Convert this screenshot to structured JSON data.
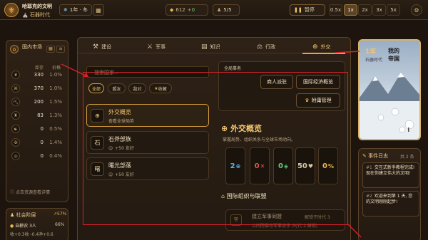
{
  "header": {
    "civ_name": "哈耶克的文明",
    "era": "石器时代",
    "year": "1年 · 冬",
    "gold": "612",
    "gold_delta": "+0",
    "population": "5/5",
    "pause_label": "暂停",
    "speeds": [
      "0.5x",
      "1x",
      "2x",
      "3x",
      "5x"
    ],
    "active_speed": "1x"
  },
  "left_panel": {
    "market_title": "国内市场",
    "col_stock": "库存",
    "col_price": "价格",
    "resources": [
      {
        "icon": "grain-icon",
        "glyph": "❦",
        "stock": "330",
        "price": "1.0%"
      },
      {
        "icon": "wood-icon",
        "glyph": "⌘",
        "stock": "370",
        "price": "1.0%"
      },
      {
        "icon": "stone-icon",
        "glyph": "⛏",
        "stock": "200",
        "price": "1.5%"
      },
      {
        "icon": "tool-icon",
        "glyph": "♜",
        "stock": "83",
        "price": "1.3%"
      },
      {
        "icon": "cloth-icon",
        "glyph": "☯",
        "stock": "0",
        "price": "0.5%"
      },
      {
        "icon": "craft-icon",
        "glyph": "✠",
        "stock": "0",
        "price": "1.4%"
      },
      {
        "icon": "gem-icon",
        "glyph": "◎",
        "stock": "0",
        "price": "0.4%"
      }
    ],
    "hint": "点击资源查看详情",
    "social_title": "社会阶层",
    "social_pct": "57%",
    "class_name": "自耕农 3人",
    "class_pct": "66%",
    "class_stats": "收+0.3收 -0.4净+0.6"
  },
  "tabs": [
    {
      "name": "tab-build",
      "icon": "hammer-icon",
      "glyph": "⚒",
      "label": "建设"
    },
    {
      "name": "tab-military",
      "icon": "swords-icon",
      "glyph": "⚔",
      "label": "军事"
    },
    {
      "name": "tab-knowledge",
      "icon": "book-icon",
      "glyph": "▤",
      "label": "知识"
    },
    {
      "name": "tab-admin",
      "icon": "gavel-icon",
      "glyph": "⚖",
      "label": "行政"
    },
    {
      "name": "tab-diplomacy",
      "icon": "globe-icon",
      "glyph": "⊕",
      "label": "外交"
    }
  ],
  "diplomacy": {
    "search_placeholder": "搜索国家...",
    "filters": [
      "全部",
      "盟友",
      "敌对",
      "收藏"
    ],
    "list": [
      {
        "glyph": "⊕",
        "name": "外交概览",
        "sub": "查看全球局势",
        "active": true
      },
      {
        "glyph": "石",
        "name": "石斧部族",
        "sub": "+50 友好",
        "active": false
      },
      {
        "glyph": "曙",
        "name": "曙光部落",
        "sub": "+50 友好",
        "active": false
      }
    ],
    "global_title": "全局事务",
    "btn_envoy": "商人派驻",
    "btn_economy": "国际经济概览",
    "btn_vassal": "附庸管理",
    "overview_title": "外交概览",
    "overview_desc": "掌握局势、组织关系与全球市场动向。",
    "stats": [
      {
        "value": "2",
        "glyph": "⊕",
        "color": "#5fb0e8"
      },
      {
        "value": "0",
        "glyph": "✕",
        "color": "#e0564a"
      },
      {
        "value": "0",
        "glyph": "◈",
        "color": "#5fd07a"
      },
      {
        "value": "50",
        "glyph": "♥",
        "color": "#d6c7a8"
      },
      {
        "value": "0",
        "glyph": "%",
        "color": "#e8b648"
      }
    ],
    "org_title": "国际组织与联盟",
    "org_item": "建立军事同盟",
    "org_unlock": "解锁于时代 3",
    "org_desc": "共同防御与军事协作 (时代 2 解锁)"
  },
  "right_panel": {
    "year_label": "1年",
    "season_label": "冬季",
    "empire_line1": "我的",
    "empire_line2": "帝国",
    "era_small": "石器时代",
    "event_log_title": "事件日志",
    "event_log_count": "共 2 条",
    "events": [
      {
        "num": "#1",
        "text": "交互式新手教程完成! 现在你建立伟大的文明!"
      },
      {
        "num": "#2",
        "text": "欢迎来到第 1 天, 您的文明刚刚起步!"
      }
    ]
  }
}
